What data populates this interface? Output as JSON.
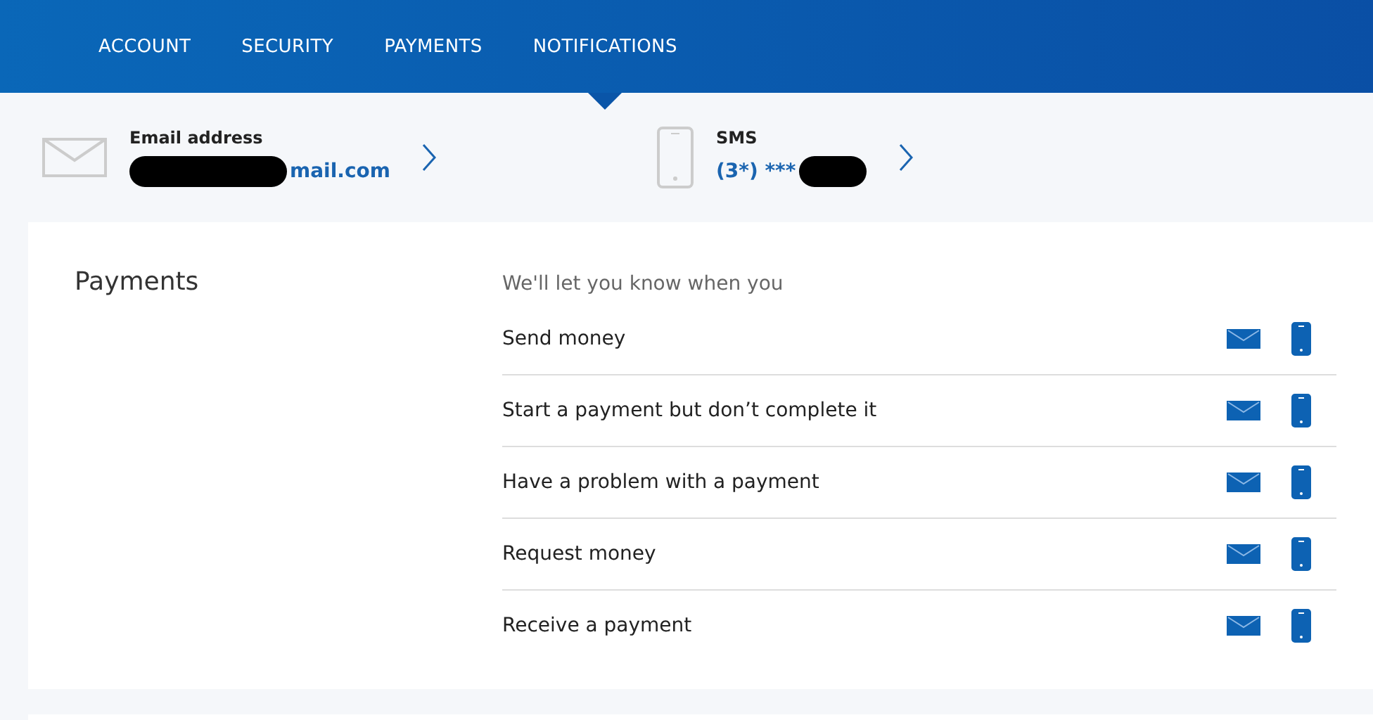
{
  "tabs": [
    {
      "label": "ACCOUNT",
      "selected": false
    },
    {
      "label": "SECURITY",
      "selected": false
    },
    {
      "label": "PAYMENTS",
      "selected": false
    },
    {
      "label": "NOTIFICATIONS",
      "selected": true
    }
  ],
  "contacts": [
    {
      "kind": "email",
      "label": "Email address",
      "value": "mail.com"
    },
    {
      "kind": "sms",
      "label": "SMS",
      "value": "(3*) ***"
    }
  ],
  "section": {
    "title": "Payments",
    "intro": "We'll let you know when you",
    "rows": [
      {
        "label": "Send money",
        "email_on": true,
        "sms_on": true
      },
      {
        "label": "Start a payment but don’t complete it",
        "email_on": true,
        "sms_on": true
      },
      {
        "label": "Have a problem with a payment",
        "email_on": true,
        "sms_on": true
      },
      {
        "label": "Request money",
        "email_on": true,
        "sms_on": true
      },
      {
        "label": "Receive a payment",
        "email_on": true,
        "sms_on": true
      }
    ]
  }
}
